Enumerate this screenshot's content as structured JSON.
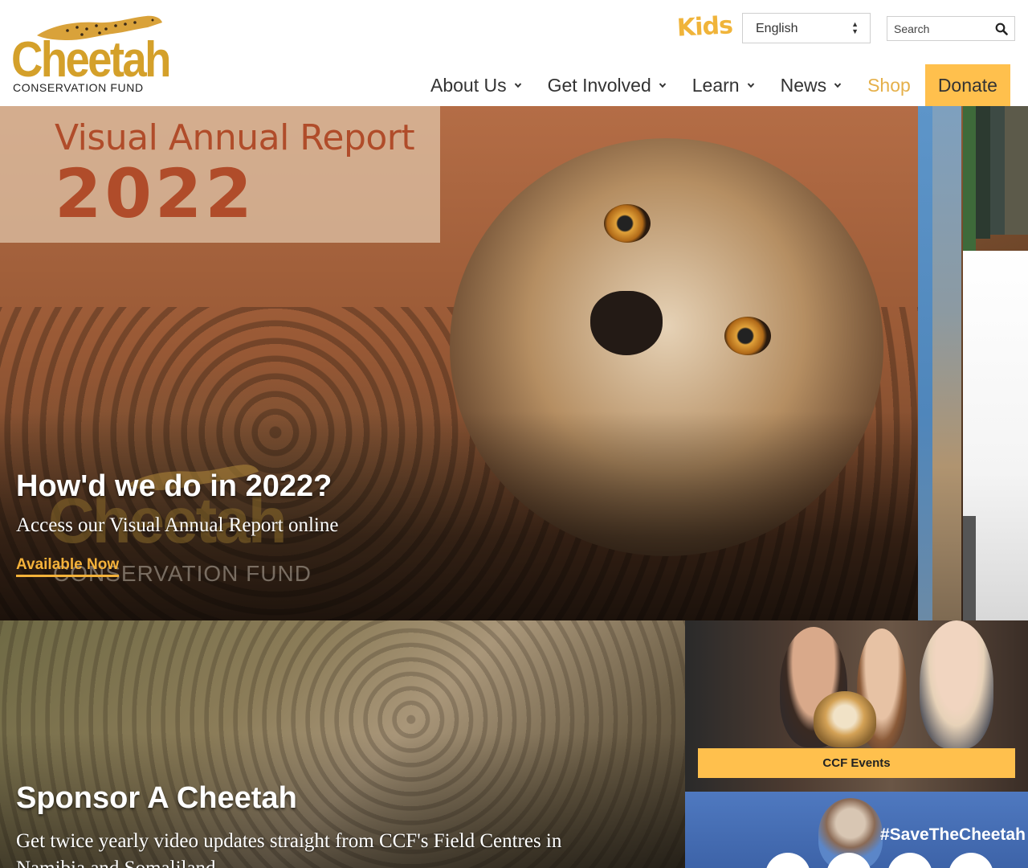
{
  "header": {
    "logo": {
      "word": "Cheetah",
      "subtitle": "CONSERVATION FUND"
    },
    "kids_label": "Kids",
    "language": {
      "selected": "English"
    },
    "search": {
      "placeholder": "Search"
    },
    "nav": [
      {
        "label": "About Us",
        "has_dropdown": true
      },
      {
        "label": "Get Involved",
        "has_dropdown": true
      },
      {
        "label": "Learn",
        "has_dropdown": true
      },
      {
        "label": "News",
        "has_dropdown": true
      },
      {
        "label": "Shop",
        "has_dropdown": false
      },
      {
        "label": "Donate",
        "has_dropdown": false
      }
    ]
  },
  "hero": {
    "image_title": "Visual Annual Report",
    "image_year": "2022",
    "watermark_word": "Cheetah",
    "watermark_sub": "CONSERVATION FUND",
    "heading": "How'd we do in 2022?",
    "subheading": "Access our Visual Annual Report online",
    "cta": "Available Now"
  },
  "sponsor": {
    "heading": "Sponsor A Cheetah",
    "text": "Get twice yearly video updates straight from CCF's Field Centres in Namibia and Somaliland"
  },
  "events": {
    "button": "CCF Events"
  },
  "social": {
    "hashtag": "#SaveTheCheetah"
  },
  "colors": {
    "brand_gold": "#d4a02a",
    "donate_bg": "#ffc04d",
    "shop_text": "#e5b04a",
    "cta_text": "#f5b23a"
  }
}
